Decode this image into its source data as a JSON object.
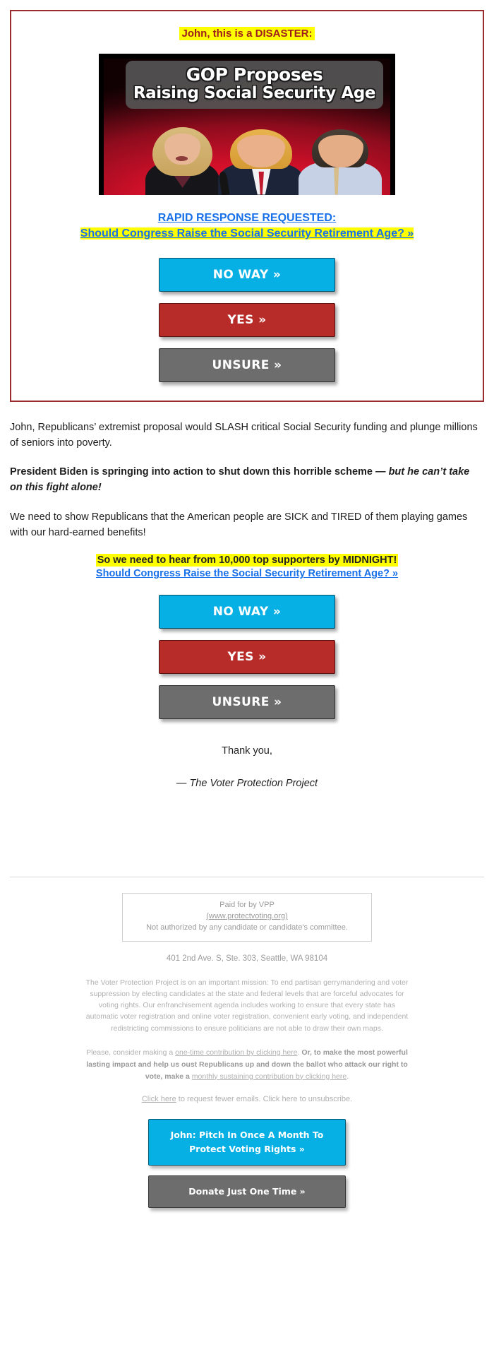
{
  "colors": {
    "card_border": "#9b2c2c",
    "highlight": "#ffff00",
    "disaster_text": "#9b1d1d",
    "link_blue": "#1871e8",
    "btn_no_way": "#07b0e4",
    "btn_yes": "#b72b28",
    "btn_unsure": "#6d6d6d",
    "footer_gray": "#b0b0b0"
  },
  "cta_card": {
    "disaster_headline": "John, this is a DISASTER:",
    "hero_image": {
      "alt": "GOP Proposes Raising Social Security Age",
      "headline_line1": "GOP Proposes",
      "headline_line2": "Raising Social Security Age",
      "background_color": "#c0102a"
    },
    "link_heading": "RAPID RESPONSE REQUESTED:",
    "link_question": "Should Congress Raise the Social Security Retirement Age? »"
  },
  "poll_buttons": [
    {
      "label": "NO WAY »",
      "name": "no-way-button",
      "style": "btn-no"
    },
    {
      "label": "YES »",
      "name": "yes-button",
      "style": "btn-yes"
    },
    {
      "label": "UNSURE »",
      "name": "unsure-button",
      "style": "btn-unsure"
    }
  ],
  "body": {
    "para1": "John, Republicans’ extremist proposal would SLASH critical Social Security funding and plunge millions of seniors into poverty.",
    "para2_bold": "President Biden is springing into action to shut down this horrible scheme —",
    "para2_italic": "but he can’t take on this fight alone!",
    "para3": "We need to show Republicans that the American people are SICK and TIRED of them playing games with our hard-earned benefits!",
    "midnight_line": "So we need to hear from 10,000 top supporters by MIDNIGHT!",
    "second_link": "Should Congress Raise the Social Security Retirement Age?  »",
    "thank_you": "Thank you,",
    "signature": "— The Voter Protection Project"
  },
  "footer": {
    "paid_for": "Paid for by VPP",
    "website": "(www.protectvoting.org)",
    "not_authorized": "Not authorized by any candidate or candidate's committee.",
    "address": "401 2nd Ave. S, Ste. 303, Seattle, WA 98104",
    "mission": "The Voter Protection Project is on an important mission: To end partisan gerrymandering and voter suppression by electing candidates at the state and federal levels that are forceful advocates for voting rights. Our enfranchisement agenda includes working to ensure that every state has automatic voter registration and online voter registration, convenient early voting, and independent redistricting commissions to ensure politicians are not able to draw their own maps.",
    "ask_prefix": "Please, consider making a ",
    "ask_link1": "one-time contribution by clicking here",
    "ask_mid": ". ",
    "ask_bold": "Or, to make the most powerful lasting impact and help us oust Republicans up and down the ballot who attack our right to vote, make a ",
    "ask_link2": "monthly sustaining contribution by clicking here",
    "ask_suffix": ".",
    "unsub_link1": "Click here",
    "unsub_mid": " to request fewer emails. Click here to unsubscribe.",
    "buttons": [
      {
        "label": "John: Pitch In Once A Month To Protect Voting Rights »",
        "name": "monthly-donate-button",
        "style": "fbtn-monthly"
      },
      {
        "label": "Donate Just One Time »",
        "name": "one-time-donate-button",
        "style": "fbtn-once"
      }
    ]
  }
}
